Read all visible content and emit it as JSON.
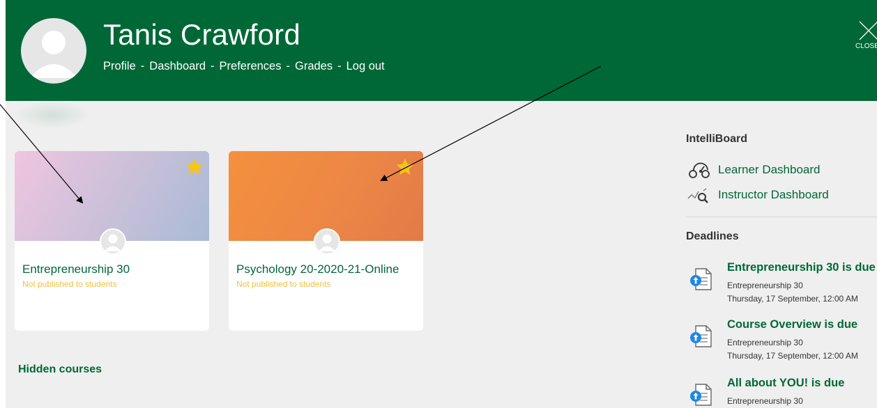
{
  "header": {
    "user_name": "Tanis Crawford",
    "nav": [
      "Profile",
      "Dashboard",
      "Preferences",
      "Grades",
      "Log out"
    ],
    "nav_separator": "-",
    "close_label": "CLOSE"
  },
  "courses": [
    {
      "name": "Entrepreneurship 30",
      "status": "Not published to students",
      "favourite": true
    },
    {
      "name": "Psychology 20-2020-21-Online",
      "status": "Not published to students",
      "favourite": true
    }
  ],
  "hidden_courses_label": "Hidden courses",
  "sidebar": {
    "intelliboard": {
      "title": "IntelliBoard",
      "links": [
        {
          "label": "Learner Dashboard",
          "icon": "speedometer-icon"
        },
        {
          "label": "Instructor Dashboard",
          "icon": "chart-search-icon"
        }
      ]
    },
    "deadlines": {
      "title": "Deadlines",
      "items": [
        {
          "title": "Entrepreneurship 30 is due",
          "course": "Entrepreneurship 30",
          "date": "Thursday, 17 September, 12:00 AM"
        },
        {
          "title": "Course Overview is due",
          "course": "Entrepreneurship 30",
          "date": "Thursday, 17 September, 12:00 AM"
        },
        {
          "title": "All about YOU! is due",
          "course": "Entrepreneurship 30",
          "date": ""
        }
      ]
    }
  },
  "colors": {
    "header_bg": "#006837",
    "accent_green": "#006837",
    "status_yellow": "#f0c040",
    "star_gold": "#f5c518",
    "page_bg": "#efefef"
  }
}
